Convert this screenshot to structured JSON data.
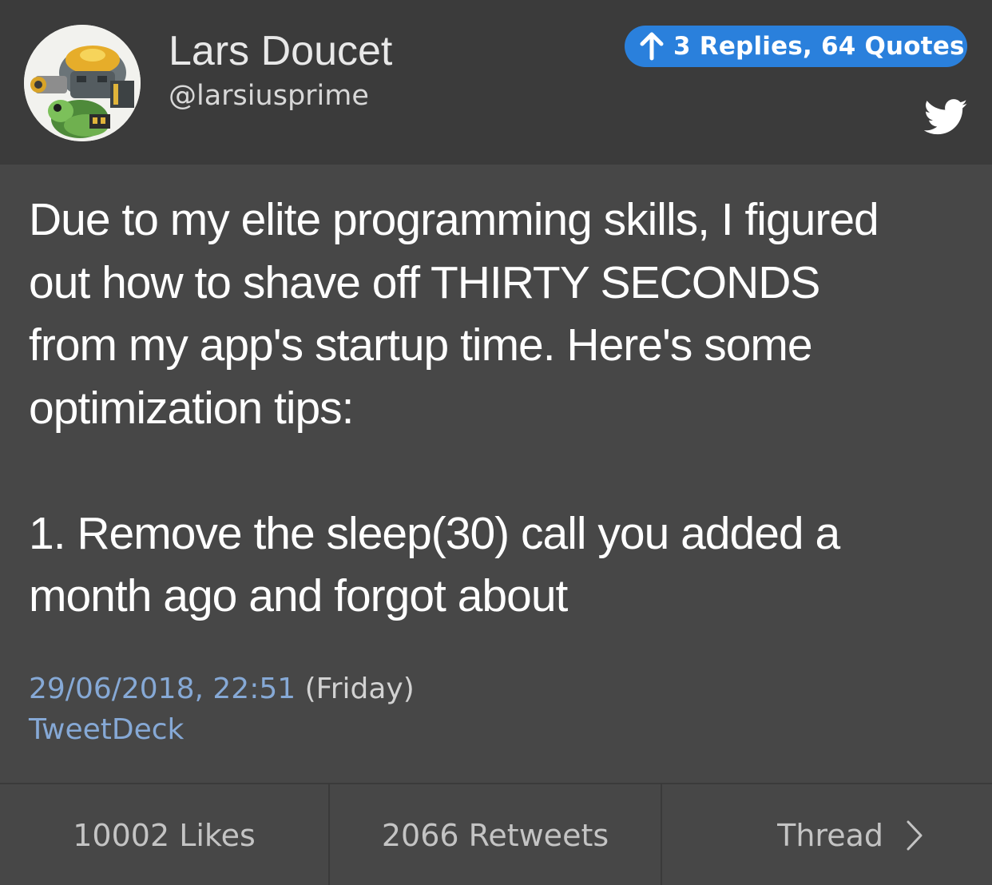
{
  "author": {
    "name": "Lars Doucet",
    "handle": "@larsiusprime"
  },
  "replies_badge": {
    "label": "3 Replies, 64 Quotes",
    "color": "#2a80dc"
  },
  "tweet": {
    "text": "Due to my elite programming skills, I figured\nout how to shave off THIRTY SECONDS\nfrom my app's startup time. Here's some\noptimization tips:\n\n1. Remove the sleep(30) call you added a\nmonth ago and forgot about",
    "timestamp": "29/06/2018, 22:51",
    "weekday": "(Friday)",
    "source": "TweetDeck"
  },
  "footer": {
    "likes": "10002 Likes",
    "retweets": "2066 Retweets",
    "thread": "Thread"
  },
  "icons": {
    "reply_arrow": "arrow-up-icon",
    "brand": "twitter-bird-icon",
    "thread": "chevron-right-icon",
    "avatar": "turtle-robot-avatar"
  },
  "colors": {
    "header_bg": "#3b3b3b",
    "body_bg": "#474747",
    "link": "#86a9d6"
  }
}
